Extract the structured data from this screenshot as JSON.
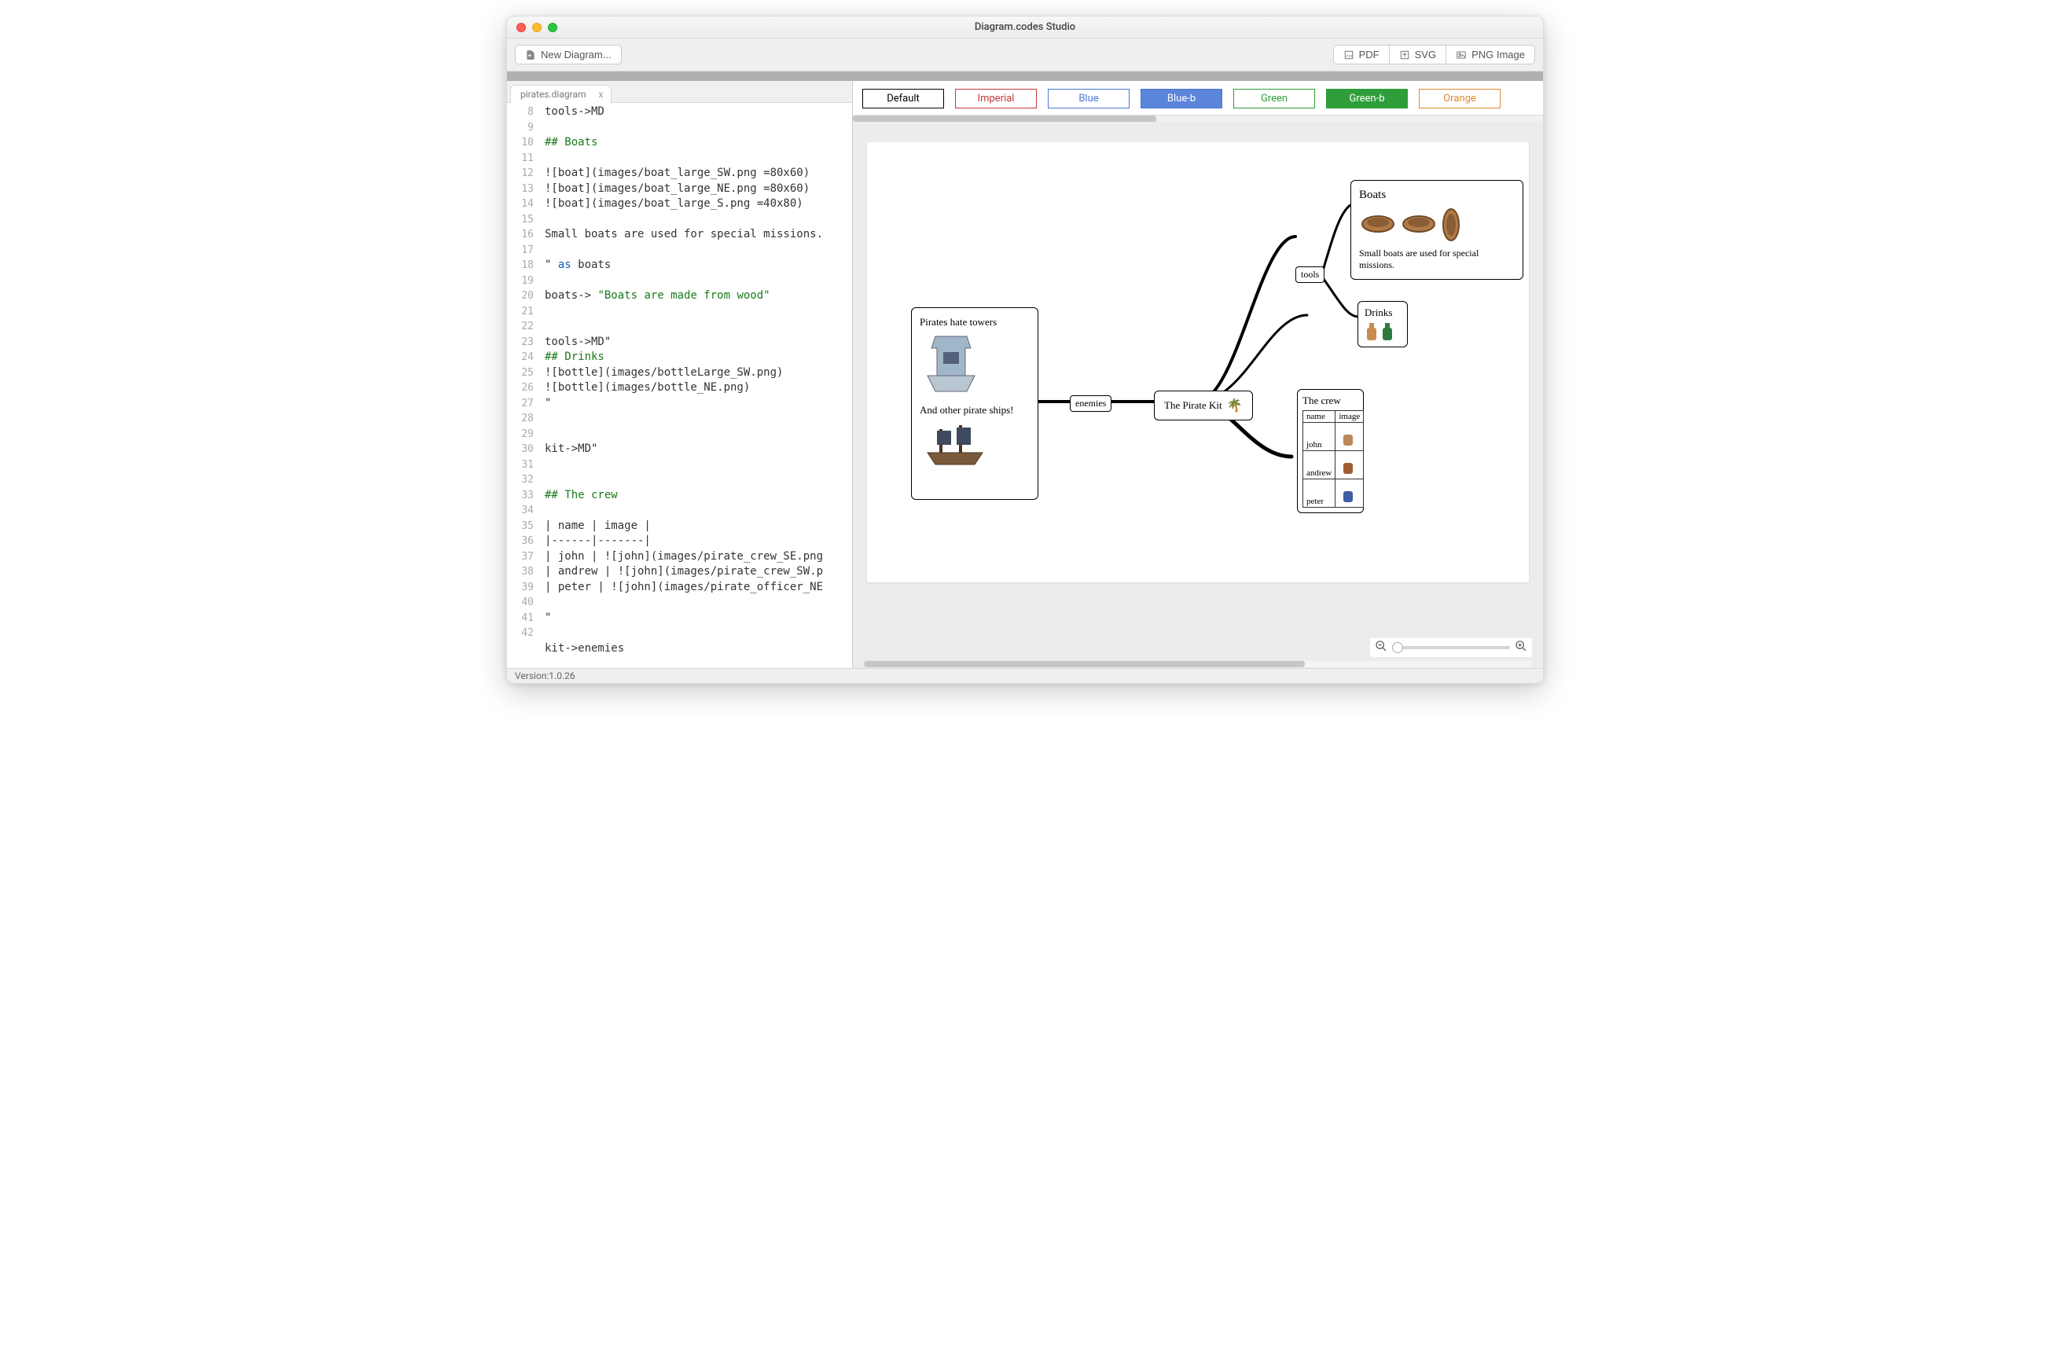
{
  "window": {
    "title": "Diagram.codes Studio"
  },
  "toolbar": {
    "new_label": "New Diagram...",
    "export": {
      "pdf": "PDF",
      "svg": "SVG",
      "png": "PNG Image"
    }
  },
  "tabs": [
    {
      "label": "pirates.diagram"
    }
  ],
  "editor": {
    "first_line_number": 8,
    "highlighted_line": 31,
    "lines": [
      "tools->MD",
      "",
      "## Boats",
      "",
      "![boat](images/boat_large_SW.png =80x60)",
      "![boat](images/boat_large_NE.png =80x60)",
      "![boat](images/boat_large_S.png =40x80)",
      "",
      "Small boats are used for special missions.",
      "",
      "\" as boats",
      "",
      "boats-> \"Boats are made from wood\"",
      "",
      "",
      "tools->MD\"",
      "## Drinks",
      "![bottle](images/bottleLarge_SW.png)",
      "![bottle](images/bottle_NE.png)",
      "\"",
      "",
      "",
      "kit->MD\"",
      "",
      "## The crew",
      "",
      "| name | image |",
      "|------|-------|",
      "| john | ![john](images/pirate_crew_SE.png",
      "| andrew | ![john](images/pirate_crew_SW.p",
      "| peter | ![john](images/pirate_officer_NE",
      "",
      "\"",
      "",
      "kit->enemies"
    ]
  },
  "themes": [
    {
      "label": "Default",
      "border": "#000000",
      "text": "#000000",
      "fill": "#ffffff"
    },
    {
      "label": "Imperial",
      "border": "#c33a3a",
      "text": "#c33a3a",
      "fill": "#ffffff"
    },
    {
      "label": "Blue",
      "border": "#4b77d1",
      "text": "#4b77d1",
      "fill": "#ffffff"
    },
    {
      "label": "Blue-b",
      "border": "#4b77d1",
      "text": "#ffffff",
      "fill": "#5a85db"
    },
    {
      "label": "Green",
      "border": "#2f9d3a",
      "text": "#2f9d3a",
      "fill": "#ffffff"
    },
    {
      "label": "Green-b",
      "border": "#2f9d3a",
      "text": "#ffffff",
      "fill": "#2f9d3a"
    },
    {
      "label": "Orange",
      "border": "#e08a2d",
      "text": "#e08a2d",
      "fill": "#ffffff"
    }
  ],
  "diagram": {
    "center": {
      "label": "The Pirate Kit"
    },
    "enemies": {
      "edge_label": "enemies",
      "text_top": "Pirates hate towers",
      "text_bottom": "And other pirate ships!"
    },
    "tools": {
      "edge_label": "tools"
    },
    "boats": {
      "title": "Boats",
      "caption": "Small boats are used for special missions."
    },
    "drinks": {
      "title": "Drinks"
    },
    "crew": {
      "title": "The crew",
      "columns": [
        "name",
        "image"
      ],
      "rows": [
        {
          "name": "john"
        },
        {
          "name": "andrew"
        },
        {
          "name": "peter"
        }
      ]
    }
  },
  "status": {
    "version": "Version:1.0.26"
  }
}
